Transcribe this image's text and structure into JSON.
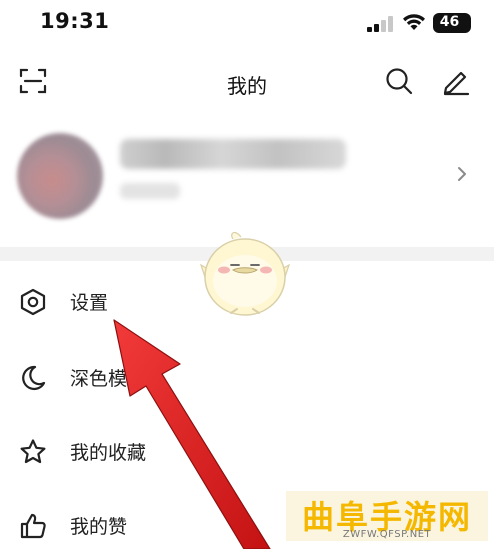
{
  "status_bar": {
    "time": "19:31",
    "battery": "46"
  },
  "header": {
    "title": "我的"
  },
  "icons": {
    "scan": "scan-icon",
    "search": "search-icon",
    "edit": "edit-icon",
    "settings": "hexagon-gear-icon",
    "dark_mode": "moon-icon",
    "favorites": "star-icon",
    "likes": "thumbs-up-icon"
  },
  "menu": {
    "items": [
      {
        "label": "设置"
      },
      {
        "label": "深色模式"
      },
      {
        "label": "我的收藏"
      },
      {
        "label": "我的赞"
      }
    ]
  },
  "watermark": {
    "brand": "曲阜手游网",
    "url": "ZWFW.QFSP.NET"
  },
  "colors": {
    "arrow": "#e01c1c",
    "watermark": "#f5b800",
    "divider": "#f2f2f2"
  }
}
